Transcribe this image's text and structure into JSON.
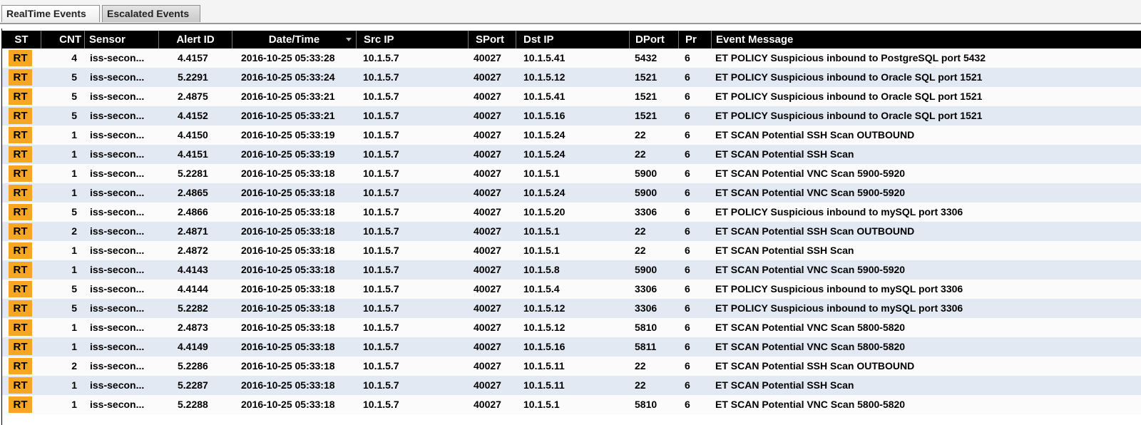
{
  "tabs": [
    {
      "label": "RealTime Events",
      "active": true
    },
    {
      "label": "Escalated Events",
      "active": false
    }
  ],
  "columns": {
    "st": "ST",
    "cnt": "CNT",
    "sensor": "Sensor",
    "alert_id": "Alert ID",
    "datetime": "Date/Time",
    "src_ip": "Src IP",
    "sport": "SPort",
    "dst_ip": "Dst IP",
    "dport": "DPort",
    "pr": "Pr",
    "event_message": "Event Message"
  },
  "sorted_column": "datetime",
  "sort_direction": "descending",
  "colors": {
    "header_bg": "#000000",
    "row_alt": "#e2e9f2",
    "status_badge": "#f5a623"
  },
  "rows": [
    {
      "st": "RT",
      "cnt": "4",
      "sensor": "iss-secon...",
      "alert_id": "4.4157",
      "datetime": "2016-10-25 05:33:28",
      "src_ip": "10.1.5.7",
      "sport": "40027",
      "dst_ip": "10.1.5.41",
      "dport": "5432",
      "pr": "6",
      "msg": "ET POLICY Suspicious inbound to PostgreSQL port 5432"
    },
    {
      "st": "RT",
      "cnt": "5",
      "sensor": "iss-secon...",
      "alert_id": "5.2291",
      "datetime": "2016-10-25 05:33:24",
      "src_ip": "10.1.5.7",
      "sport": "40027",
      "dst_ip": "10.1.5.12",
      "dport": "1521",
      "pr": "6",
      "msg": "ET POLICY Suspicious inbound to Oracle SQL port 1521"
    },
    {
      "st": "RT",
      "cnt": "5",
      "sensor": "iss-secon...",
      "alert_id": "2.4875",
      "datetime": "2016-10-25 05:33:21",
      "src_ip": "10.1.5.7",
      "sport": "40027",
      "dst_ip": "10.1.5.41",
      "dport": "1521",
      "pr": "6",
      "msg": "ET POLICY Suspicious inbound to Oracle SQL port 1521"
    },
    {
      "st": "RT",
      "cnt": "5",
      "sensor": "iss-secon...",
      "alert_id": "4.4152",
      "datetime": "2016-10-25 05:33:21",
      "src_ip": "10.1.5.7",
      "sport": "40027",
      "dst_ip": "10.1.5.16",
      "dport": "1521",
      "pr": "6",
      "msg": "ET POLICY Suspicious inbound to Oracle SQL port 1521"
    },
    {
      "st": "RT",
      "cnt": "1",
      "sensor": "iss-secon...",
      "alert_id": "4.4150",
      "datetime": "2016-10-25 05:33:19",
      "src_ip": "10.1.5.7",
      "sport": "40027",
      "dst_ip": "10.1.5.24",
      "dport": "22",
      "pr": "6",
      "msg": "ET SCAN Potential SSH Scan OUTBOUND"
    },
    {
      "st": "RT",
      "cnt": "1",
      "sensor": "iss-secon...",
      "alert_id": "4.4151",
      "datetime": "2016-10-25 05:33:19",
      "src_ip": "10.1.5.7",
      "sport": "40027",
      "dst_ip": "10.1.5.24",
      "dport": "22",
      "pr": "6",
      "msg": "ET SCAN Potential SSH Scan"
    },
    {
      "st": "RT",
      "cnt": "1",
      "sensor": "iss-secon...",
      "alert_id": "5.2281",
      "datetime": "2016-10-25 05:33:18",
      "src_ip": "10.1.5.7",
      "sport": "40027",
      "dst_ip": "10.1.5.1",
      "dport": "5900",
      "pr": "6",
      "msg": "ET SCAN Potential VNC Scan 5900-5920"
    },
    {
      "st": "RT",
      "cnt": "1",
      "sensor": "iss-secon...",
      "alert_id": "2.4865",
      "datetime": "2016-10-25 05:33:18",
      "src_ip": "10.1.5.7",
      "sport": "40027",
      "dst_ip": "10.1.5.24",
      "dport": "5900",
      "pr": "6",
      "msg": "ET SCAN Potential VNC Scan 5900-5920"
    },
    {
      "st": "RT",
      "cnt": "5",
      "sensor": "iss-secon...",
      "alert_id": "2.4866",
      "datetime": "2016-10-25 05:33:18",
      "src_ip": "10.1.5.7",
      "sport": "40027",
      "dst_ip": "10.1.5.20",
      "dport": "3306",
      "pr": "6",
      "msg": "ET POLICY Suspicious inbound to mySQL port 3306"
    },
    {
      "st": "RT",
      "cnt": "2",
      "sensor": "iss-secon...",
      "alert_id": "2.4871",
      "datetime": "2016-10-25 05:33:18",
      "src_ip": "10.1.5.7",
      "sport": "40027",
      "dst_ip": "10.1.5.1",
      "dport": "22",
      "pr": "6",
      "msg": "ET SCAN Potential SSH Scan OUTBOUND"
    },
    {
      "st": "RT",
      "cnt": "1",
      "sensor": "iss-secon...",
      "alert_id": "2.4872",
      "datetime": "2016-10-25 05:33:18",
      "src_ip": "10.1.5.7",
      "sport": "40027",
      "dst_ip": "10.1.5.1",
      "dport": "22",
      "pr": "6",
      "msg": "ET SCAN Potential SSH Scan"
    },
    {
      "st": "RT",
      "cnt": "1",
      "sensor": "iss-secon...",
      "alert_id": "4.4143",
      "datetime": "2016-10-25 05:33:18",
      "src_ip": "10.1.5.7",
      "sport": "40027",
      "dst_ip": "10.1.5.8",
      "dport": "5900",
      "pr": "6",
      "msg": "ET SCAN Potential VNC Scan 5900-5920"
    },
    {
      "st": "RT",
      "cnt": "5",
      "sensor": "iss-secon...",
      "alert_id": "4.4144",
      "datetime": "2016-10-25 05:33:18",
      "src_ip": "10.1.5.7",
      "sport": "40027",
      "dst_ip": "10.1.5.4",
      "dport": "3306",
      "pr": "6",
      "msg": "ET POLICY Suspicious inbound to mySQL port 3306"
    },
    {
      "st": "RT",
      "cnt": "5",
      "sensor": "iss-secon...",
      "alert_id": "5.2282",
      "datetime": "2016-10-25 05:33:18",
      "src_ip": "10.1.5.7",
      "sport": "40027",
      "dst_ip": "10.1.5.12",
      "dport": "3306",
      "pr": "6",
      "msg": "ET POLICY Suspicious inbound to mySQL port 3306"
    },
    {
      "st": "RT",
      "cnt": "1",
      "sensor": "iss-secon...",
      "alert_id": "2.4873",
      "datetime": "2016-10-25 05:33:18",
      "src_ip": "10.1.5.7",
      "sport": "40027",
      "dst_ip": "10.1.5.12",
      "dport": "5810",
      "pr": "6",
      "msg": "ET SCAN Potential VNC Scan 5800-5820"
    },
    {
      "st": "RT",
      "cnt": "1",
      "sensor": "iss-secon...",
      "alert_id": "4.4149",
      "datetime": "2016-10-25 05:33:18",
      "src_ip": "10.1.5.7",
      "sport": "40027",
      "dst_ip": "10.1.5.16",
      "dport": "5811",
      "pr": "6",
      "msg": "ET SCAN Potential VNC Scan 5800-5820"
    },
    {
      "st": "RT",
      "cnt": "2",
      "sensor": "iss-secon...",
      "alert_id": "5.2286",
      "datetime": "2016-10-25 05:33:18",
      "src_ip": "10.1.5.7",
      "sport": "40027",
      "dst_ip": "10.1.5.11",
      "dport": "22",
      "pr": "6",
      "msg": "ET SCAN Potential SSH Scan OUTBOUND"
    },
    {
      "st": "RT",
      "cnt": "1",
      "sensor": "iss-secon...",
      "alert_id": "5.2287",
      "datetime": "2016-10-25 05:33:18",
      "src_ip": "10.1.5.7",
      "sport": "40027",
      "dst_ip": "10.1.5.11",
      "dport": "22",
      "pr": "6",
      "msg": "ET SCAN Potential SSH Scan"
    },
    {
      "st": "RT",
      "cnt": "1",
      "sensor": "iss-secon...",
      "alert_id": "5.2288",
      "datetime": "2016-10-25 05:33:18",
      "src_ip": "10.1.5.7",
      "sport": "40027",
      "dst_ip": "10.1.5.1",
      "dport": "5810",
      "pr": "6",
      "msg": "ET SCAN Potential VNC Scan 5800-5820"
    }
  ]
}
